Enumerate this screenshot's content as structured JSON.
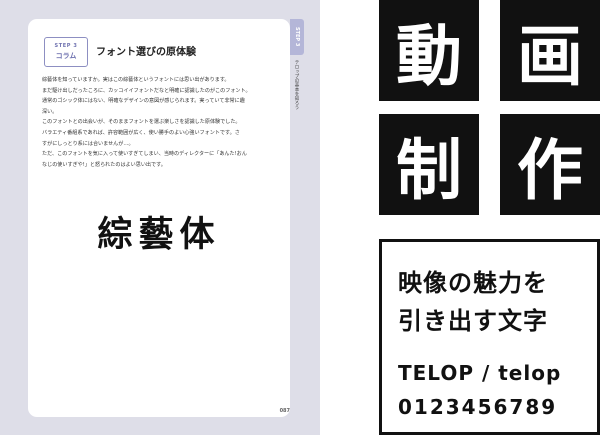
{
  "book_page": {
    "step_label": "STEP 3",
    "column_label": "コラム",
    "title": "フォント選びの原体験",
    "paragraphs": [
      "綜藝体を知っていますか。実はこの綜藝体というフォントには思い出があります。",
      "まだ駆け出しだったころに、カッコイイフォントだなと明確に認識したのがこのフォント。",
      "通常のゴシック体にはない、明確なデザインの意図が感じられます。実っていて非常に趣",
      "深い。",
      "このフォントとの出会いが、そのままフォントを選ぶ楽しさを認識した原体験でした。",
      "バラエティ番組系であれば、許容範囲が広く、使い勝手のよい心強いフォントです。さ",
      "すがにしっとり系には合いませんが…。",
      "ただ、このフォントを気に入って使いすぎてしまい、当時のディレクターに「あんた!おん",
      "なじの使いすぎや!」と怒られたのはよい思い出です。"
    ],
    "sample_font": "綜藝体",
    "page_number": "087",
    "side_tab": "STEP 3",
    "side_caption": "テロップの基本を知ろう"
  },
  "tiles": [
    "動",
    "画",
    "制",
    "作"
  ],
  "sample_box": {
    "line1": "映像の魅力を",
    "line2": "引き出す文字",
    "latin": "TELOP / telop",
    "digits": "0123456789"
  }
}
